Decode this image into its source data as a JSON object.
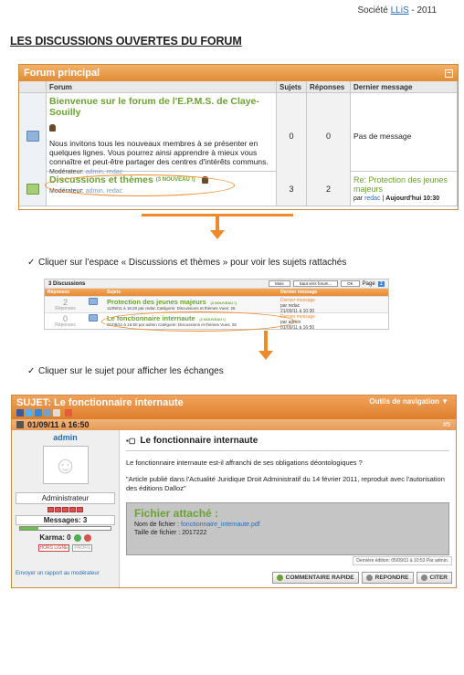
{
  "header": {
    "company_prefix": "Société ",
    "company_brand": "LLiS",
    "year_suffix": " - 2011",
    "page_title": "LES DISCUSSIONS OUVERTES DU FORUM"
  },
  "forum_main": {
    "title": "Forum principal",
    "minimize_glyph": "−",
    "columns": [
      "Forum",
      "Sujets",
      "Réponses",
      "Dernier message"
    ],
    "rows": [
      {
        "title": "Bienvenue sur le forum de l'E.P.M.S. de Claye-Souilly",
        "description": "Nous invitons tous les nouveaux membres à se présenter en quelques lignes. Vous pourrez ainsi apprendre à mieux vous connaître et peut-être partager des centres d'intérêts communs.",
        "moderators_label": "Modérateur:",
        "moderators": "admin, redac",
        "subjects": "0",
        "replies": "0",
        "last_message": "Pas de message"
      },
      {
        "title": "Discussions et thèmes",
        "new_badge": "(3 NOUVEAU !)",
        "moderators_label": "Modérateur:",
        "moderators": "admin, redac",
        "subjects": "3",
        "replies": "2",
        "last_title": "Re: Protection des jeunes majeurs",
        "last_by_prefix": "par ",
        "last_by": "redac",
        "last_date": "Aujourd'hui 10:30"
      }
    ]
  },
  "instructions": [
    "Cliquer sur l’espace « Discussions et thèmes » pour voir les sujets rattachés",
    "Cliquer sur le sujet pour afficher les échanges"
  ],
  "check_glyph": "✓",
  "forum_topics": {
    "count_label": "3 Discussions",
    "select1": "Mois",
    "select2": "Saut vers forum...",
    "ok": "OK",
    "page_label": "Page",
    "page_num": "1",
    "columns": [
      "Réponses",
      "Sujets",
      "Dernier message"
    ],
    "rows": [
      {
        "count": "2",
        "count_label": "Réponses",
        "title": "Protection des jeunes majeurs",
        "badge": "(2 NOUVEAU !)",
        "meta": "11/09/11 à 16:20 par redac Catégorie: Discussions et thèmes Vues: 26",
        "last_label": "Dernier message",
        "last_by": "par redac",
        "last_date": "21/09/11 à 10:30"
      },
      {
        "count": "0",
        "count_label": "Réponses",
        "title": "Le fonctionnaire internaute",
        "badge": "(1 NOUVEAU !)",
        "meta": "01/09/11 à 16:50 par admin Catégorie: Discussions et thèmes Vues: 26",
        "last_label": "Dernier message",
        "last_by": "par admin",
        "last_date": "01/09/11 à 16:50"
      }
    ]
  },
  "topic": {
    "title": "SUJET: Le fonctionnaire internaute",
    "nav_label": "Outils de navigation ▼",
    "date": "01/09/11 à 16:50",
    "post_number": "#5",
    "author": {
      "name": "admin",
      "role": "Administrateur",
      "messages": "Messages: 3",
      "karma": "Karma: 0",
      "status_offline": "HORS LIGNE",
      "status_profile": "PROFIL",
      "report": "Envoyer un rapport au modérateur"
    },
    "post_title": "Le fonctionnaire internaute",
    "paragraph1": "Le fonctionnaire internaute est-il affranchi de ses obligations déontologiques ?",
    "paragraph2": "\"Article publié dans l'Actualité Juridique Droit Administratif du 14 février 2011, reproduit avec l'autorisation des éditions Dalloz\"",
    "attachment": {
      "heading": "Fichier attaché :",
      "name_label": "Nom de fichier : ",
      "name_value": "fonctionnaire_internaute.pdf",
      "size_label": "Taille de fichier : ",
      "size_value": "2017222"
    },
    "edited": "Dernière édition: 05/09/11 à 10:53 Par admin.",
    "buttons": {
      "quick_reply": "COMMENTAIRE RAPIDE",
      "reply": "REPONDRE",
      "quote": "CITER"
    }
  },
  "colors": {
    "accent_orange": "#ef8a2b",
    "forum_green": "#6aa233",
    "link_blue": "#2a6db0"
  }
}
